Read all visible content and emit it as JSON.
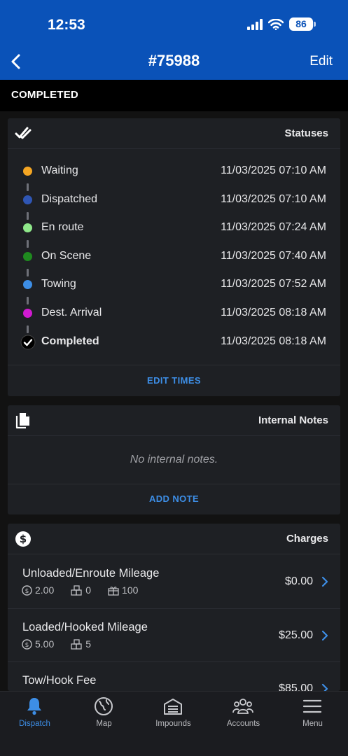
{
  "status_bar": {
    "time": "12:53",
    "battery": "86"
  },
  "nav": {
    "title": "#75988",
    "edit_label": "Edit"
  },
  "banner": {
    "state": "COMPLETED"
  },
  "statuses_card": {
    "title": "Statuses",
    "items": [
      {
        "label": "Waiting",
        "time": "11/03/2025 07:10 AM",
        "color": "#f5a623"
      },
      {
        "label": "Dispatched",
        "time": "11/03/2025 07:10 AM",
        "color": "#2f56b4"
      },
      {
        "label": "En route",
        "time": "11/03/2025 07:24 AM",
        "color": "#8fe88a"
      },
      {
        "label": "On Scene",
        "time": "11/03/2025 07:40 AM",
        "color": "#1f8a1f"
      },
      {
        "label": "Towing",
        "time": "11/03/2025 07:52 AM",
        "color": "#3d8ee6"
      },
      {
        "label": "Dest. Arrival",
        "time": "11/03/2025 08:18 AM",
        "color": "#d11ad1"
      },
      {
        "label": "Completed",
        "time": "11/03/2025 08:18 AM",
        "color": "#000000"
      }
    ],
    "action_label": "EDIT TIMES"
  },
  "notes_card": {
    "title": "Internal Notes",
    "empty_text": "No internal notes.",
    "action_label": "ADD NOTE"
  },
  "charges_card": {
    "title": "Charges",
    "items": [
      {
        "name": "Unloaded/Enroute Mileage",
        "rate": "2.00",
        "qty": "0",
        "free": "100",
        "amount": "$0.00"
      },
      {
        "name": "Loaded/Hooked Mileage",
        "rate": "5.00",
        "qty": "5",
        "amount": "$25.00"
      },
      {
        "name": "Tow/Hook Fee",
        "amount": "$85.00"
      }
    ]
  },
  "tabbar": {
    "tabs": [
      {
        "label": "Dispatch"
      },
      {
        "label": "Map"
      },
      {
        "label": "Impounds"
      },
      {
        "label": "Accounts"
      },
      {
        "label": "Menu"
      }
    ]
  },
  "colors": {
    "accent": "#3d8ee6",
    "header_blue": "#0a52b8"
  }
}
